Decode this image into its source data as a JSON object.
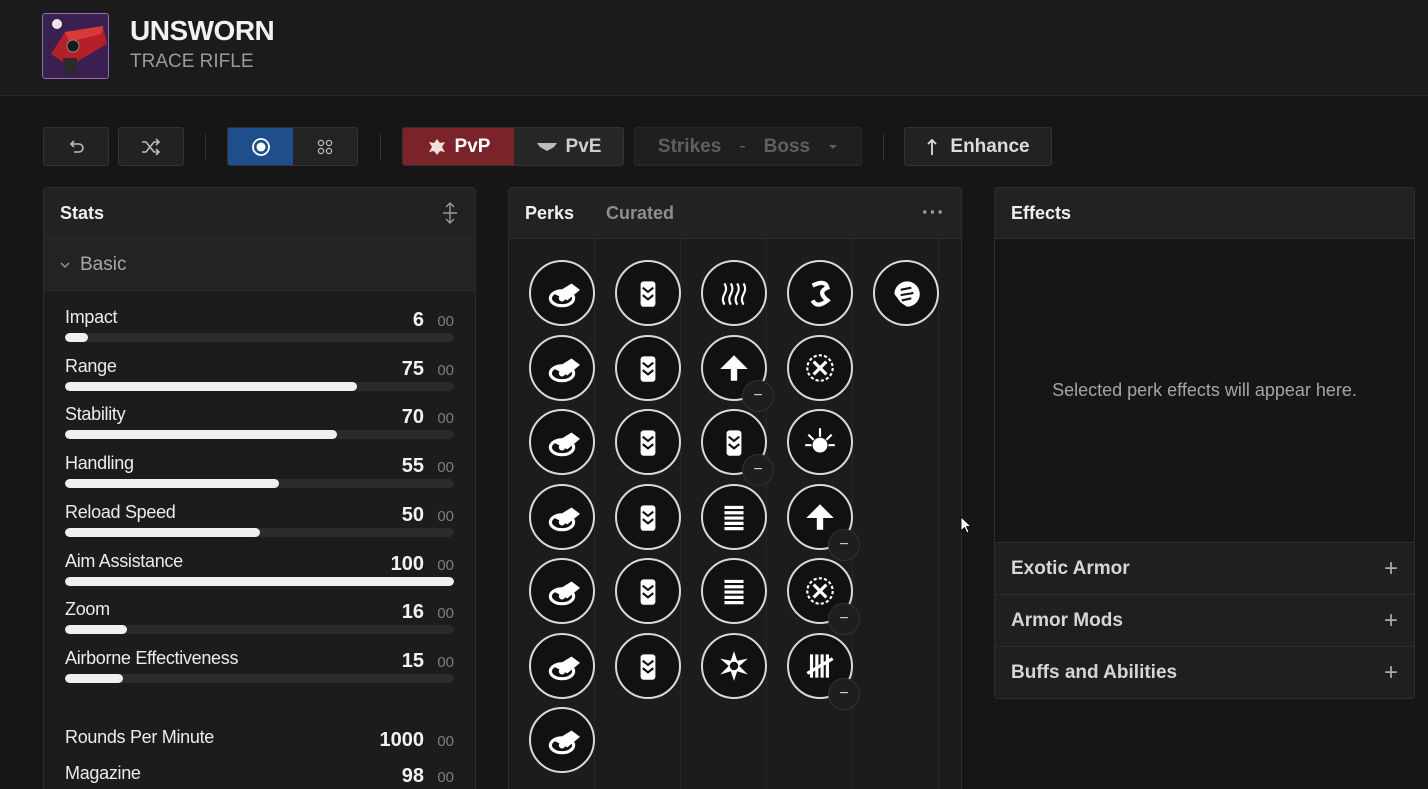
{
  "weapon": {
    "name": "UNSWORN",
    "type": "TRACE RIFLE"
  },
  "toolbar": {
    "mode_pvp": "PvP",
    "mode_pve": "PvE",
    "activity": "Strikes",
    "activity_sep": "-",
    "activity_sub": "Boss",
    "enhance": "Enhance",
    "accent_pvp": "#7a2328",
    "accent_view": "#1f4e8c"
  },
  "stats": {
    "title": "Stats",
    "section": "Basic",
    "bars": [
      {
        "name": "Impact",
        "value": "6",
        "suffix": "00",
        "pct": 6
      },
      {
        "name": "Range",
        "value": "75",
        "suffix": "00",
        "pct": 75
      },
      {
        "name": "Stability",
        "value": "70",
        "suffix": "00",
        "pct": 70
      },
      {
        "name": "Handling",
        "value": "55",
        "suffix": "00",
        "pct": 55
      },
      {
        "name": "Reload Speed",
        "value": "50",
        "suffix": "00",
        "pct": 50
      },
      {
        "name": "Aim Assistance",
        "value": "100",
        "suffix": "00",
        "pct": 100
      },
      {
        "name": "Zoom",
        "value": "16",
        "suffix": "00",
        "pct": 16
      },
      {
        "name": "Airborne Effectiveness",
        "value": "15",
        "suffix": "00",
        "pct": 15
      }
    ],
    "extra": [
      {
        "name": "Rounds Per Minute",
        "value": "1000",
        "suffix": "00"
      },
      {
        "name": "Magazine",
        "value": "98",
        "suffix": "00"
      }
    ]
  },
  "perks": {
    "title": "Perks",
    "tab_curated": "Curated",
    "more": "···",
    "badge": "−"
  },
  "effects": {
    "title": "Effects",
    "empty": "Selected perk effects will appear here.",
    "sections": [
      "Exotic Armor",
      "Armor Mods",
      "Buffs and Abilities"
    ],
    "plus": "+"
  }
}
